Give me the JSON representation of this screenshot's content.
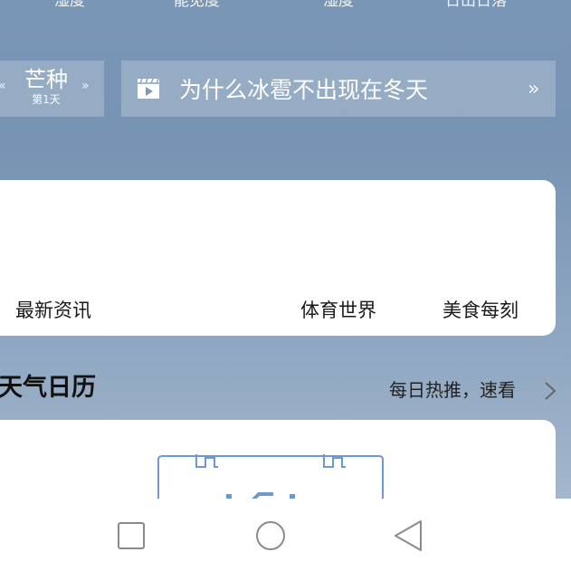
{
  "top_labels": [
    "湿度",
    "能见度",
    "湿度",
    "日出日落"
  ],
  "solar_term": {
    "name": "芒种",
    "day": "第1天"
  },
  "article": {
    "title": "为什么冰雹不出现在冬天",
    "more_icon": "double-chevron-right-icon",
    "icon": "video-icon"
  },
  "news_tabs": [
    "最新资讯",
    "体育世界",
    "美食每刻"
  ],
  "calendar_section": {
    "title": "天气日历",
    "link": "每日热推，速看"
  },
  "nav_bar": {
    "buttons": [
      "recent-apps",
      "home",
      "back"
    ]
  },
  "colors": {
    "sky_top": "#7a96b6",
    "sky_bottom": "#a3b6cc",
    "card": "#ffffff",
    "calendar_accent": "#6f98d0"
  }
}
